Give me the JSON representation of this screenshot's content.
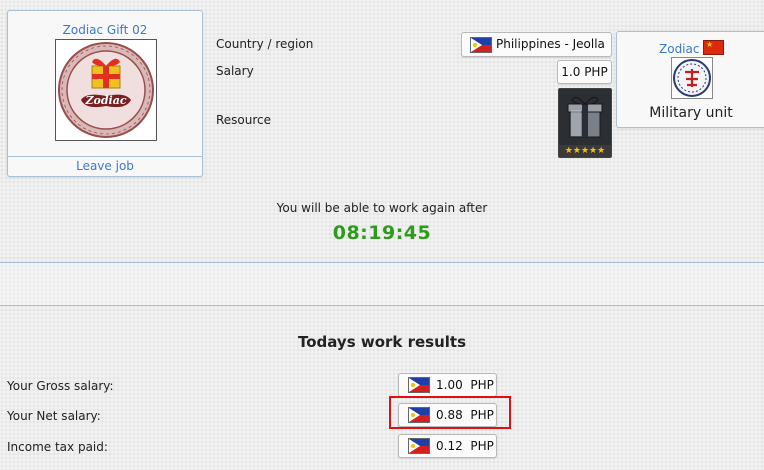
{
  "company": {
    "name": "Zodiac Gift 02",
    "leave_job_label": "Leave job",
    "logo_text": "Zodiac"
  },
  "job_info": {
    "country_label": "Country / region",
    "country_value": "Philippines -  Jeolla",
    "salary_label": "Salary",
    "salary_value": "1.0 PHP",
    "resource_label": "Resource",
    "resource_quality_stars": 5
  },
  "military_unit": {
    "name": "Zodiac",
    "label": "Military unit"
  },
  "work_status": {
    "message": "You will be able to work again after",
    "timer": "08:19:45"
  },
  "results": {
    "title": "Todays work results",
    "rows": [
      {
        "label": "Your Gross salary:",
        "amount": "1.00",
        "currency": "PHP"
      },
      {
        "label": "Your Net salary:",
        "amount": "0.88",
        "currency": "PHP"
      },
      {
        "label": "Income tax paid:",
        "amount": "0.12",
        "currency": "PHP"
      }
    ]
  },
  "colors": {
    "link": "#3a7ac8",
    "timer": "#2e9b1e",
    "highlight": "#e01010",
    "border": "#a9c0d6"
  },
  "icons": {
    "country_flag": "philippines-flag-icon",
    "unit_flag": "china-flag-icon",
    "resource": "gift-box-icon"
  }
}
